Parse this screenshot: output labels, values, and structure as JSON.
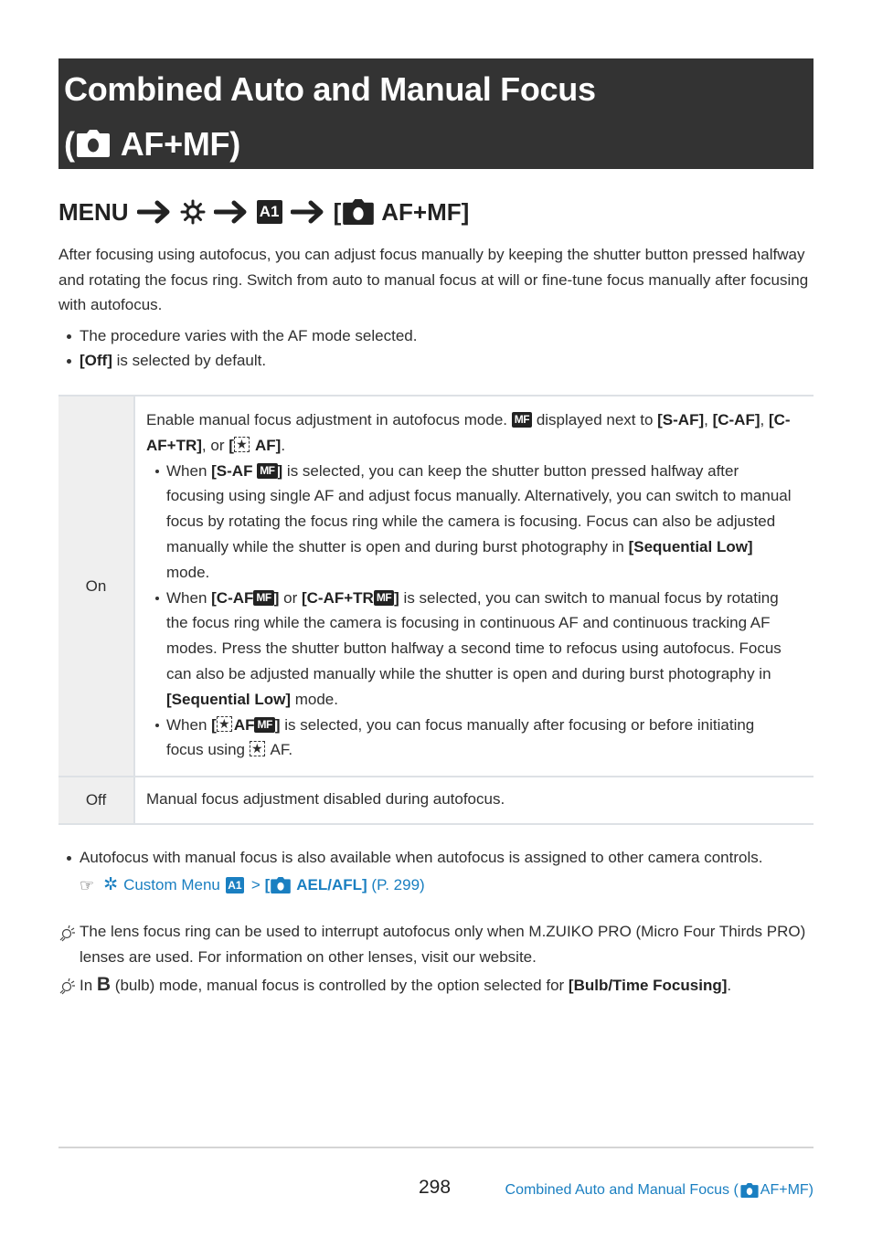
{
  "title": {
    "line1": "Combined Auto and Manual Focus",
    "line2_prefix": "(",
    "line2_text": "AF+MF)",
    "icon": "camera-icon"
  },
  "menu_path": {
    "menu": "MENU",
    "steps": [
      "gear-icon",
      "a1-tab-icon",
      "camera-icon"
    ],
    "tab_label": "A1",
    "open_bracket": "[",
    "item": "AF+MF]",
    "arrow": "arrow-right-icon"
  },
  "intro": {
    "paragraph": "After focusing using autofocus, you can adjust focus manually by keeping the shutter button pressed halfway and rotating the focus ring. Switch from auto to manual focus at will or fine-tune focus manually after focusing with autofocus.",
    "bullets": [
      {
        "bold": "",
        "text": "The procedure varies with the AF mode selected."
      },
      {
        "bold": "[Off]",
        "text": " is selected by default."
      }
    ]
  },
  "table": {
    "rows": [
      {
        "key": "On",
        "desc_a": "Enable manual focus adjustment in autofocus mode.",
        "desc_b": " displayed next to ",
        "desc_saf": "[S-AF]",
        "desc_caf": "[C-AF]",
        "desc_caftr": "[C-AF+TR]",
        "desc_or": ", or ",
        "desc_staraf_open": "[",
        "desc_staraf": " AF]",
        "mf_badge": "MF",
        "bullets": {
          "b1_when": "When ",
          "b1_mode": "[S-AF ",
          "b1_close": "]",
          "b1_text": " is selected, you can keep the shutter button pressed halfway after focusing using single AF and adjust focus manually. Alternatively, you can switch to manual focus by rotating the focus ring while the camera is focusing. Focus can also be adjusted manually while the shutter is open and during burst photography in ",
          "b1_seq": "[Sequential Low]",
          "b1_end": " mode.",
          "b2_when": "When ",
          "b2_mode1": "[C-AF",
          "b2_close1": "]",
          "b2_or": " or ",
          "b2_mode2": "[C-AF+TR",
          "b2_close2": "]",
          "b2_text": " is selected, you can switch to manual focus by rotating the focus ring while the camera is focusing in continuous AF and continuous tracking AF modes. Press the shutter button halfway a second time to refocus using autofocus. Focus can also be adjusted manually while the shutter is open and during burst photography in ",
          "b2_seq": "[Sequential Low]",
          "b2_end": " mode.",
          "b3_when": "When ",
          "b3_open": "[",
          "b3_af": "AF",
          "b3_close": "]",
          "b3_text": " is selected, you can focus manually after focusing or before initiating focus using ",
          "b3_end": " AF."
        }
      },
      {
        "key": "Off",
        "description": "Manual focus adjustment disabled during autofocus."
      }
    ]
  },
  "after_table": {
    "bullet": "Autofocus with manual focus is also available when autofocus is assigned to other camera controls.",
    "reference": {
      "icon": "pointing-hand-icon",
      "gear": "gear-icon",
      "menu": "Custom Menu",
      "tab": "A1",
      "sep": ">",
      "open": "[",
      "item": "AEL/AFL]",
      "page": "(P. 299)"
    }
  },
  "notes": [
    {
      "icon": "tip-bulb-icon",
      "text": "The lens focus ring can be used to interrupt autofocus only when M.ZUIKO PRO (Micro Four Thirds PRO) lenses are used. For information on other lenses, visit our website."
    },
    {
      "icon": "tip-bulb-icon",
      "pre": "In ",
      "mode": "B",
      "mid": " (bulb) mode, manual focus is controlled by the option selected for ",
      "bold": "[Bulb/Time Focusing]",
      "end": "."
    }
  ],
  "footer": {
    "page_number": "298",
    "section_prefix": "Combined Auto and Manual Focus (",
    "section_suffix": " AF+MF)"
  },
  "colors": {
    "title_bg": "#333333",
    "link": "#1a7fc1",
    "table_key_bg": "#efefef",
    "rule": "#dde1e5"
  }
}
